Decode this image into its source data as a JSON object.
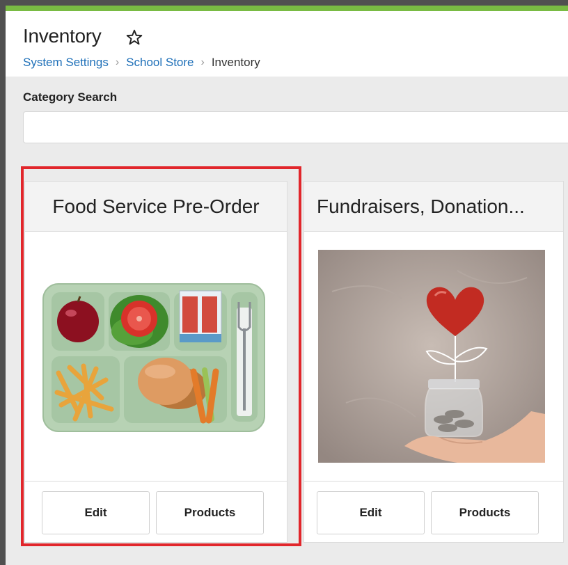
{
  "header": {
    "title": "Inventory",
    "favorite_icon": "star-outline-icon",
    "breadcrumb": [
      {
        "label": "System Settings"
      },
      {
        "label": "School Store"
      },
      {
        "label": "Inventory"
      }
    ]
  },
  "search": {
    "label": "Category Search",
    "value": "",
    "placeholder": ""
  },
  "cards": [
    {
      "title": "Food Service Pre-Order",
      "image": "lunch-tray-image",
      "edit_label": "Edit",
      "products_label": "Products",
      "highlighted": true
    },
    {
      "title": "Fundraisers, Donation...",
      "image": "donation-jar-heart-image",
      "edit_label": "Edit",
      "products_label": "Products",
      "highlighted": false
    }
  ],
  "colors": {
    "accent_bar": "#79bb43",
    "link": "#1d6fb8",
    "highlight": "#e1262b"
  }
}
